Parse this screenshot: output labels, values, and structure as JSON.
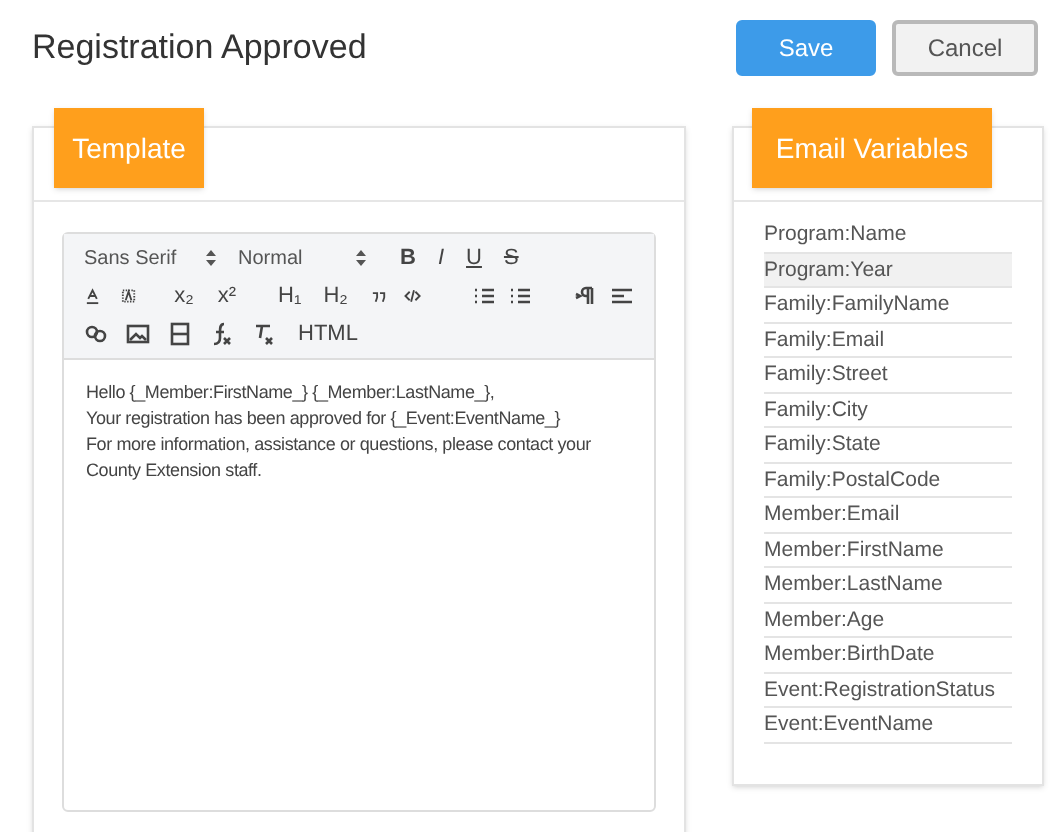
{
  "title": "Registration Approved",
  "buttons": [
    {
      "label": "Save",
      "kind": "primary"
    },
    {
      "label": "Cancel",
      "kind": "secondary"
    }
  ],
  "template": {
    "tag": "Template",
    "toolbar": {
      "font_select": "Sans Serif",
      "size_select": "Normal",
      "format_buttons": [
        "B",
        "I",
        "U",
        "S"
      ],
      "script_buttons": [
        "x₂",
        "x²"
      ],
      "heading_buttons": [
        "H₁",
        "H₂"
      ],
      "html_button": "HTML"
    },
    "body": [
      "Hello {_Member:FirstName_} {_Member:LastName_},",
      "Your registration has been approved for {_Event:EventName_}",
      "For more information, assistance or questions, please contact your County Extension staff."
    ]
  },
  "variables": {
    "tag": "Email Variables",
    "items": [
      {
        "label": "Program:Name",
        "selected": false
      },
      {
        "label": "Program:Year",
        "selected": true
      },
      {
        "label": "Family:FamilyName",
        "selected": false
      },
      {
        "label": "Family:Email",
        "selected": false
      },
      {
        "label": "Family:Street",
        "selected": false
      },
      {
        "label": "Family:City",
        "selected": false
      },
      {
        "label": "Family:State",
        "selected": false
      },
      {
        "label": "Family:PostalCode",
        "selected": false
      },
      {
        "label": "Member:Email",
        "selected": false
      },
      {
        "label": "Member:FirstName",
        "selected": false
      },
      {
        "label": "Member:LastName",
        "selected": false
      },
      {
        "label": "Member:Age",
        "selected": false
      },
      {
        "label": "Member:BirthDate",
        "selected": false
      },
      {
        "label": "Event:RegistrationStatus",
        "selected": false
      },
      {
        "label": "Event:EventName",
        "selected": false
      }
    ]
  }
}
